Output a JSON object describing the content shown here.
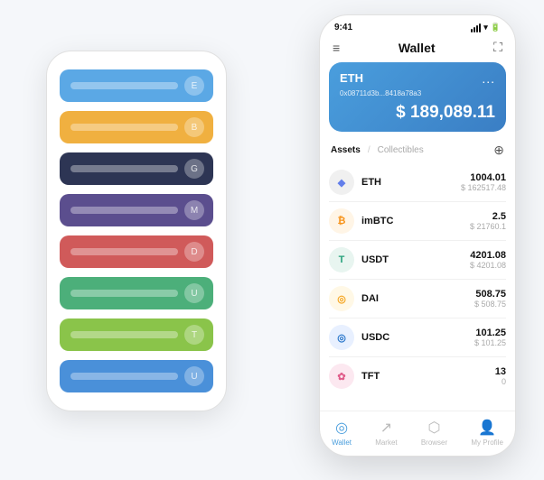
{
  "scene": {
    "background": "#f5f7fa"
  },
  "phoneBack": {
    "cards": [
      {
        "id": "card-blue",
        "color": "#5ba8e5",
        "iconText": "E"
      },
      {
        "id": "card-orange",
        "color": "#f0b040",
        "iconText": "B"
      },
      {
        "id": "card-dark",
        "color": "#2d3554",
        "iconText": "G"
      },
      {
        "id": "card-purple",
        "color": "#5b4e8e",
        "iconText": "M"
      },
      {
        "id": "card-red",
        "color": "#d05a5a",
        "iconText": "D"
      },
      {
        "id": "card-green",
        "color": "#4caf7a",
        "iconText": "U"
      },
      {
        "id": "card-lime",
        "color": "#8ac44a",
        "iconText": "T"
      },
      {
        "id": "card-blue2",
        "color": "#4a90d9",
        "iconText": "U"
      }
    ]
  },
  "phoneFront": {
    "statusBar": {
      "time": "9:41",
      "battery": "▮"
    },
    "header": {
      "menuIcon": "≡",
      "title": "Wallet",
      "scanIcon": "⛶"
    },
    "ethCard": {
      "coinName": "ETH",
      "address": "0x08711d3b...8418a78a3",
      "dots": "...",
      "balancePrefix": "$",
      "balance": "189,089.11"
    },
    "assetsTabs": {
      "activeTab": "Assets",
      "inactiveTab": "Collectibles",
      "separator": "/"
    },
    "assets": [
      {
        "name": "ETH",
        "iconBg": "#f0f0f0",
        "iconColor": "#627eea",
        "iconSymbol": "◆",
        "amount": "1004.01",
        "usdValue": "$ 162517.48"
      },
      {
        "name": "imBTC",
        "iconBg": "#fff5e6",
        "iconColor": "#f7931a",
        "iconSymbol": "₿",
        "amount": "2.5",
        "usdValue": "$ 21760.1"
      },
      {
        "name": "USDT",
        "iconBg": "#e8f5f0",
        "iconColor": "#26a17b",
        "iconSymbol": "T",
        "amount": "4201.08",
        "usdValue": "$ 4201.08"
      },
      {
        "name": "DAI",
        "iconBg": "#fff8e6",
        "iconColor": "#f5a623",
        "iconSymbol": "◎",
        "amount": "508.75",
        "usdValue": "$ 508.75"
      },
      {
        "name": "USDC",
        "iconBg": "#e8f0ff",
        "iconColor": "#2775ca",
        "iconSymbol": "◎",
        "amount": "101.25",
        "usdValue": "$ 101.25"
      },
      {
        "name": "TFT",
        "iconBg": "#fce8f0",
        "iconColor": "#e05c8a",
        "iconSymbol": "✿",
        "amount": "13",
        "usdValue": "0"
      }
    ],
    "bottomNav": [
      {
        "id": "wallet",
        "icon": "◎",
        "label": "Wallet",
        "active": true
      },
      {
        "id": "market",
        "icon": "📈",
        "label": "Market",
        "active": false
      },
      {
        "id": "browser",
        "icon": "🌐",
        "label": "Browser",
        "active": false
      },
      {
        "id": "profile",
        "icon": "👤",
        "label": "My Profile",
        "active": false
      }
    ]
  }
}
